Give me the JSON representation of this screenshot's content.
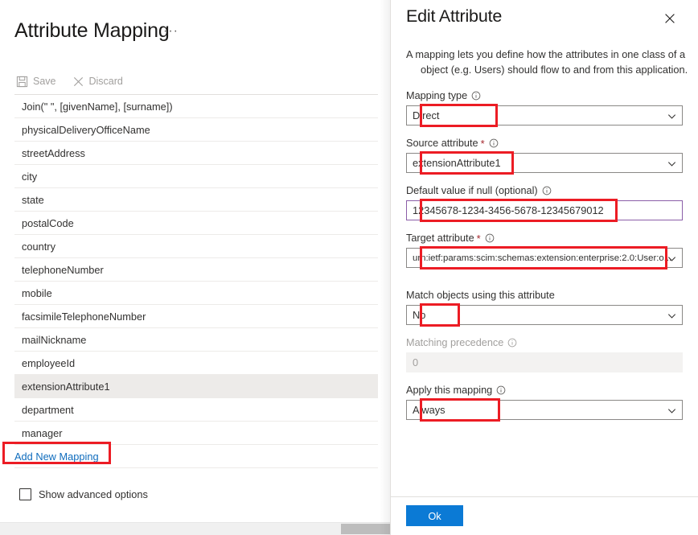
{
  "left": {
    "title": "Attribute Mapping",
    "title_overflow": "···",
    "toolbar": {
      "save_label": "Save",
      "save_icon": "save-disk-icon",
      "discard_label": "Discard",
      "discard_icon": "close-x-icon"
    },
    "mappings": [
      "Join(\" \", [givenName], [surname])",
      "physicalDeliveryOfficeName",
      "streetAddress",
      "city",
      "state",
      "postalCode",
      "country",
      "telephoneNumber",
      "mobile",
      "facsimileTelephoneNumber",
      "mailNickname",
      "employeeId",
      "extensionAttribute1",
      "department",
      "manager"
    ],
    "selected_mapping": "extensionAttribute1",
    "add_new_mapping_label": "Add New Mapping",
    "show_advanced_options_label": "Show advanced options",
    "show_advanced_options_checked": false
  },
  "panel": {
    "title": "Edit Attribute",
    "close_icon": "close-x-icon",
    "description_line1": "A mapping lets you define how the attributes in one class of a",
    "description_line2": "object (e.g. Users) should flow to and from this application.",
    "fields": {
      "mapping_type": {
        "label": "Mapping type",
        "required": false,
        "info_icon": "info-circle-icon",
        "value": "Direct",
        "control": "dropdown"
      },
      "source_attribute": {
        "label": "Source attribute",
        "required": true,
        "info_icon": "info-circle-icon",
        "value": "extensionAttribute1",
        "control": "dropdown"
      },
      "default_value": {
        "label": "Default value if null (optional)",
        "required": false,
        "info_icon": "info-circle-icon",
        "value": "12345678-1234-3456-5678-12345679012",
        "control": "textbox",
        "focused": true
      },
      "target_attribute": {
        "label": "Target attribute",
        "required": true,
        "info_icon": "info-circle-icon",
        "value": "urn:ietf:params:scim:schemas:extension:enterprise:2.0:User:o...",
        "control": "dropdown"
      },
      "match_objects": {
        "label": "Match objects using this attribute",
        "required": false,
        "value": "No",
        "control": "dropdown"
      },
      "matching_precedence": {
        "label": "Matching precedence",
        "required": false,
        "info_icon": "info-circle-icon",
        "value": "0",
        "control": "textbox",
        "disabled": true
      },
      "apply_this_mapping": {
        "label": "Apply this mapping",
        "required": false,
        "info_icon": "info-circle-icon",
        "value": "Always",
        "control": "dropdown"
      }
    },
    "ok_label": "Ok"
  },
  "colors": {
    "accent_blue": "#0b7ad5",
    "link_blue": "#0f6cbd",
    "annotation_red": "#ec1c24",
    "focus_purple": "#8b5ea8",
    "selected_row": "#edebe9",
    "required_star": "#a4262c"
  }
}
